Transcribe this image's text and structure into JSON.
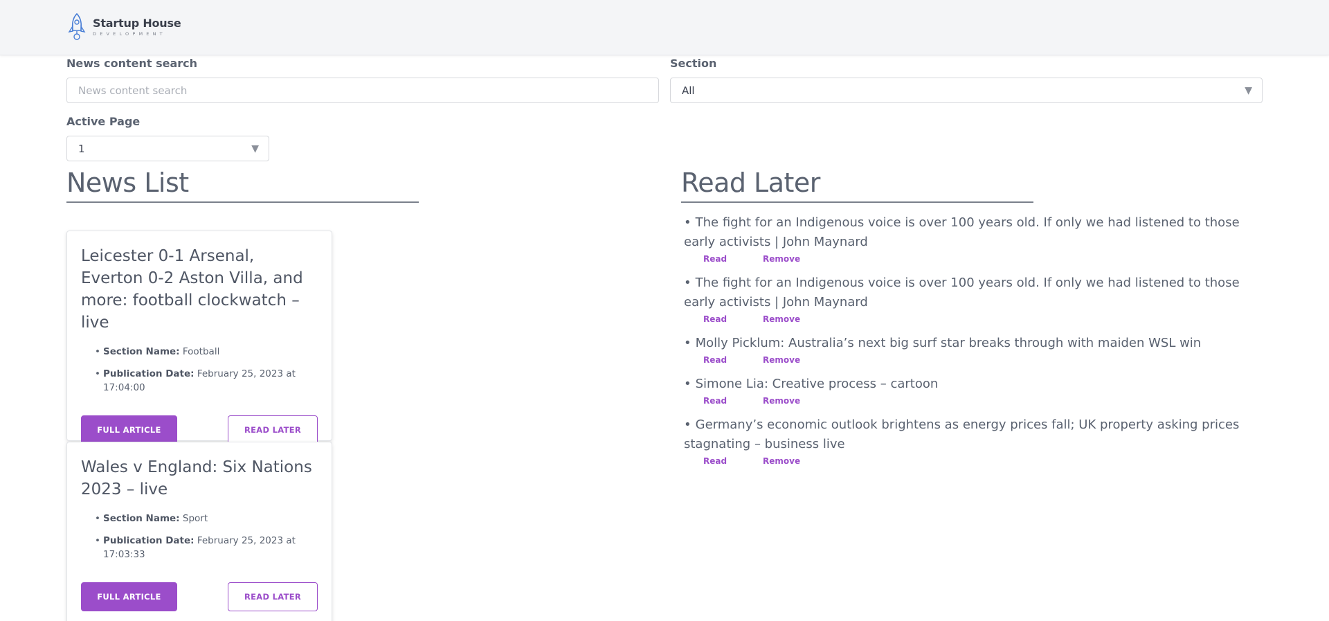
{
  "header": {
    "logo_name": "Startup House",
    "logo_sub": "DEVELOPMENT"
  },
  "filters": {
    "search_label": "News content search",
    "search_placeholder": "News content search",
    "search_value": "",
    "section_label": "Section",
    "section_value": "All",
    "page_label": "Active Page",
    "page_value": "1"
  },
  "news_list": {
    "title": "News List",
    "section_label": "Section Name:",
    "date_label": "Publication Date:",
    "full_article_label": "FULL ARTICLE",
    "read_later_label": "READ LATER",
    "items": [
      {
        "title": "Leicester 0-1 Arsenal, Everton 0-2 Aston Villa, and more: football clockwatch – live",
        "section": "Football",
        "date": "February 25, 2023 at 17:04:00"
      },
      {
        "title": "Wales v England: Six Nations 2023 – live",
        "section": "Sport",
        "date": "February 25, 2023 at 17:03:33"
      }
    ]
  },
  "read_later": {
    "title": "Read Later",
    "read_label": "Read",
    "remove_label": "Remove",
    "items": [
      {
        "title": "The fight for an Indigenous voice is over 100 years old. If only we had listened to those early activists | John Maynard"
      },
      {
        "title": "The fight for an Indigenous voice is over 100 years old. If only we had listened to those early activists | John Maynard"
      },
      {
        "title": "Molly Picklum: Australia’s next big surf star breaks through with maiden WSL win"
      },
      {
        "title": "Simone Lia: Creative process – cartoon"
      },
      {
        "title": "Germany’s economic outlook brightens as energy prices fall; UK property asking prices stagnating – business live"
      }
    ]
  },
  "colors": {
    "accent": "#9b4dca",
    "text": "#5a6270",
    "header_bg": "#f4f5f7"
  },
  "icons": {
    "logo": "rocket-icon",
    "dropdown": "caret-down-icon"
  }
}
